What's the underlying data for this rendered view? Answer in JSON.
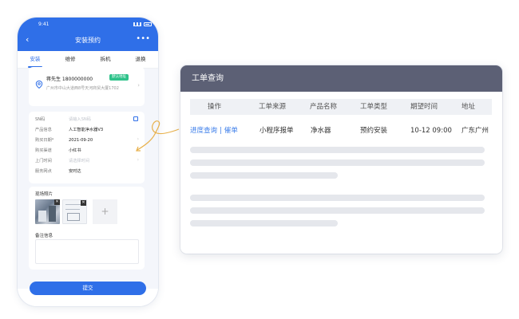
{
  "phone": {
    "status_time": "9:41",
    "nav": {
      "back_icon": "chevron-left-icon",
      "title": "安装预约",
      "more_icon": "more-dots-icon"
    },
    "tabs": [
      {
        "label": "安装",
        "active": true
      },
      {
        "label": "维修",
        "active": false
      },
      {
        "label": "拆机",
        "active": false
      },
      {
        "label": "退换",
        "active": false
      }
    ],
    "address": {
      "name_phone": "蒋先生 1800000000",
      "badge": "默认地址",
      "line": "广州市中山大道西8号天河商贸大厦1702"
    },
    "form": {
      "sn": {
        "label": "SN码",
        "placeholder": "请输入SN码"
      },
      "product": {
        "label": "产品信息",
        "value": "人工智能净水器V3"
      },
      "date": {
        "label": "购买日期*",
        "value": "2021-09-20"
      },
      "channel": {
        "label": "购买渠道",
        "value": "小红书"
      },
      "visit_time": {
        "label": "上门时间",
        "placeholder": "请选择时间"
      },
      "service_point": {
        "label": "服务网点",
        "value": "安时达"
      }
    },
    "photos": {
      "title": "现场照片",
      "add_icon": "plus-icon",
      "delete_icon": "close-icon"
    },
    "remark": {
      "title": "备注信息"
    },
    "submit_label": "提交"
  },
  "panel": {
    "title": "工单查询",
    "columns": [
      "操作",
      "工单来源",
      "产品名称",
      "工单类型",
      "期望时间",
      "地址"
    ],
    "row": {
      "actions": [
        "进度查询",
        "催单"
      ],
      "separator": "|",
      "source": "小程序报单",
      "product": "净水器",
      "type": "预约安装",
      "time": "10-12 09:00",
      "address": "广东广州"
    }
  },
  "colors": {
    "primary": "#2f6fe8",
    "panel_header": "#5c6075",
    "badge_green": "#2ec28a",
    "link": "#3b7dea",
    "skeleton": "#e5e7ec"
  }
}
